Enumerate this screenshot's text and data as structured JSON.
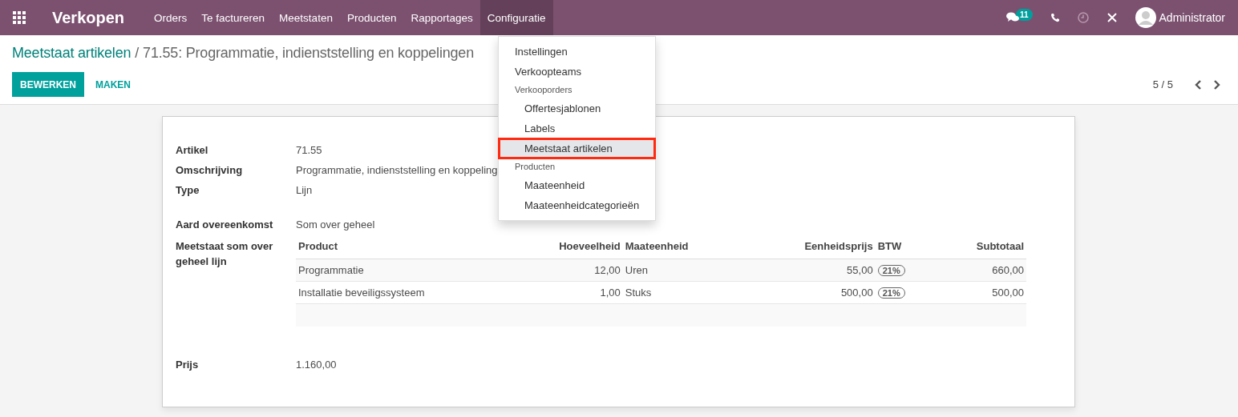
{
  "navbar": {
    "app_title": "Verkopen",
    "menu": [
      {
        "label": "Orders",
        "selected": false
      },
      {
        "label": "Te factureren",
        "selected": false
      },
      {
        "label": "Meetstaten",
        "selected": false
      },
      {
        "label": "Producten",
        "selected": false
      },
      {
        "label": "Rapportages",
        "selected": false
      },
      {
        "label": "Configuratie",
        "selected": true
      }
    ],
    "messages_badge": "11",
    "user": "Administrator"
  },
  "dropdown": {
    "items": [
      {
        "kind": "item",
        "label": "Instellingen",
        "selected": false
      },
      {
        "kind": "item",
        "label": "Verkoopteams",
        "selected": false
      },
      {
        "kind": "header",
        "label": "Verkooporders",
        "selected": false
      },
      {
        "kind": "subitem",
        "label": "Offertesjablonen",
        "selected": false
      },
      {
        "kind": "subitem",
        "label": "Labels",
        "selected": false
      },
      {
        "kind": "subitem",
        "label": "Meetstaat artikelen",
        "selected": true
      },
      {
        "kind": "header",
        "label": "Producten",
        "selected": false
      },
      {
        "kind": "subitem",
        "label": "Maateenheid",
        "selected": false
      },
      {
        "kind": "subitem",
        "label": "Maateenheidcategorieën",
        "selected": false
      }
    ]
  },
  "breadcrumb": {
    "parent": "Meetstaat artikelen",
    "separator": "/",
    "current": "71.55: Programmatie, indienststelling en koppelingen"
  },
  "buttons": {
    "edit": "BEWERKEN",
    "create": "MAKEN"
  },
  "pager": "5 / 5",
  "form": {
    "fields": [
      {
        "label": "Artikel",
        "value": "71.55"
      },
      {
        "label": "Omschrijving",
        "value": "Programmatie, indienststelling en koppeling"
      },
      {
        "label": "Type",
        "value": "Lijn"
      }
    ],
    "agreement": {
      "label": "Aard overeenkomst",
      "value": "Som over geheel"
    },
    "lines_label": "Meetstaat som over geheel lijn",
    "table": {
      "columns": [
        "Product",
        "Hoeveelheid",
        "Maateenheid",
        "Eenheidsprijs",
        "BTW",
        "Subtotaal"
      ],
      "rows": [
        [
          "Programmatie",
          "12,00",
          "Uren",
          "55,00",
          "21%",
          "660,00"
        ],
        [
          "Installatie beveiligssysteem",
          "1,00",
          "Stuks",
          "500,00",
          "21%",
          "500,00"
        ]
      ]
    },
    "price": {
      "label": "Prijs",
      "value": "1.160,00"
    }
  }
}
